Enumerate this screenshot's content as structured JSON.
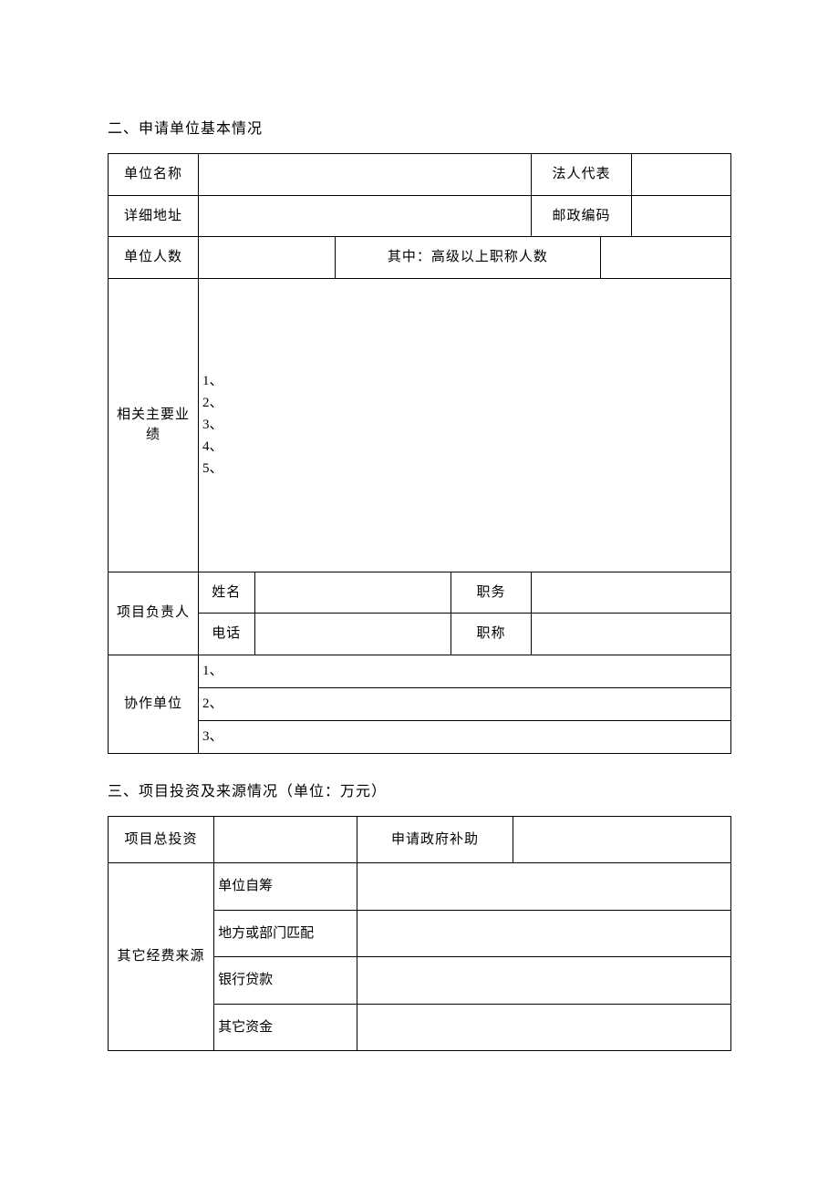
{
  "section2": {
    "heading": "二、申请单位基本情况",
    "unitName": "单位名称",
    "legalRep": "法人代表",
    "address": "详细地址",
    "postal": "邮政编码",
    "unitCount": "单位人数",
    "seniorCount": "其中：高级以上职称人数",
    "achievements": "相关主要业绩",
    "ach1": "1、",
    "ach2": "2、",
    "ach3": "3、",
    "ach4": "4、",
    "ach5": "5、",
    "projectLeader": "项目负责人",
    "name": "姓名",
    "position": "职务",
    "phone": "电话",
    "title": "职称",
    "collab": "协作单位",
    "c1": "1、",
    "c2": "2、",
    "c3": "3、"
  },
  "section3": {
    "heading": "三、项目投资及来源情况（单位：万元）",
    "totalInvest": "项目总投资",
    "govSubsidy": "申请政府补助",
    "otherSources": "其它经费来源",
    "selfRaised": "单位自筹",
    "localMatch": "地方或部门匹配",
    "bankLoan": "银行贷款",
    "otherFunds": "其它资金"
  }
}
